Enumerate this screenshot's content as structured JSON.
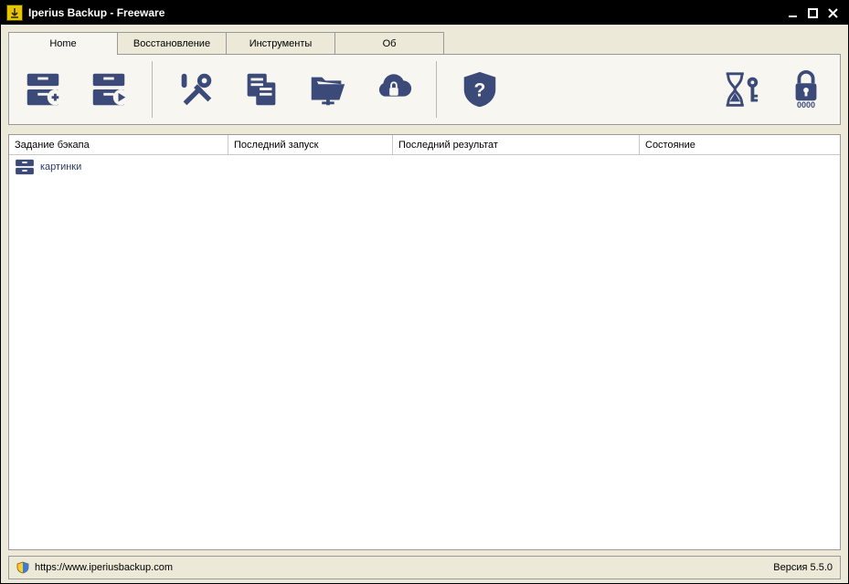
{
  "window": {
    "title": "Iperius Backup - Freeware"
  },
  "tabs": [
    {
      "label": "Home",
      "active": true
    },
    {
      "label": "Восстановление",
      "active": false
    },
    {
      "label": "Инструменты",
      "active": false
    },
    {
      "label": "Об",
      "active": false
    }
  ],
  "toolbar_icons": {
    "new_job": "archive-plus-icon",
    "run_job": "archive-play-icon",
    "tools": "tools-icon",
    "copy": "copy-icon",
    "open_folder": "open-folder-icon",
    "cloud": "cloud-lock-icon",
    "help_shield": "help-shield-icon",
    "schedule": "hourglass-key-icon",
    "lock": "lock-icon",
    "lock_label": "0000"
  },
  "columns": {
    "job": "Задание бэкапа",
    "last_run": "Последний запуск",
    "last_result": "Последний результат",
    "state": "Состояние"
  },
  "jobs": [
    {
      "name": "картинки",
      "last_run": "",
      "last_result": "",
      "state": ""
    }
  ],
  "statusbar": {
    "url": "https://www.iperiusbackup.com",
    "version": "Версия 5.5.0"
  }
}
